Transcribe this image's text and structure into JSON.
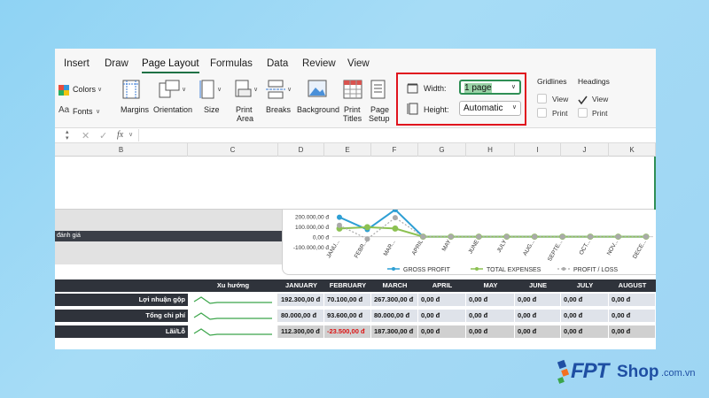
{
  "ribbon": {
    "tabs": [
      "Insert",
      "Draw",
      "Page Layout",
      "Formulas",
      "Data",
      "Review",
      "View"
    ],
    "active_tab": "Page Layout",
    "themes": {
      "colors": "Colors",
      "fonts": "Fonts"
    },
    "buttons": {
      "margins": "Margins",
      "orientation": "Orientation",
      "size": "Size",
      "print_area_1": "Print",
      "print_area_2": "Area",
      "breaks": "Breaks",
      "background": "Background",
      "print_titles_1": "Print",
      "print_titles_2": "Titles",
      "page_setup_1": "Page",
      "page_setup_2": "Setup"
    },
    "scale": {
      "width_label": "Width:",
      "width_value": "1 page",
      "height_label": "Height:",
      "height_value": "Automatic"
    },
    "gridlines": {
      "title": "Gridlines",
      "view": "View",
      "print": "Print",
      "view_checked": false,
      "print_checked": false
    },
    "headings": {
      "title": "Headings",
      "view": "View",
      "print": "Print",
      "view_checked": true,
      "print_checked": false
    }
  },
  "formula_bar": {
    "fx": "fx",
    "value": ""
  },
  "columns": [
    "B",
    "C",
    "D",
    "E",
    "F",
    "G",
    "H",
    "I",
    "J",
    "K"
  ],
  "sheet": {
    "danh_gia": "đánh giá"
  },
  "chart_data": {
    "type": "line",
    "categories": [
      "JANU...",
      "FEBR...",
      "MAR...",
      "APRIL",
      "MAY",
      "JUNE",
      "JULY",
      "AUG...",
      "SEPTE...",
      "OCT...",
      "NOV...",
      "DECE..."
    ],
    "y_ticks": [
      "200.000,00 đ",
      "100.000,00 đ",
      "0,00 đ",
      "-100.000,00 đ"
    ],
    "ylim": [
      -100000,
      250000
    ],
    "series": [
      {
        "name": "GROSS PROFIT",
        "color": "#2e9fd4",
        "values": [
          192300,
          70100,
          267300,
          0,
          0,
          0,
          0,
          0,
          0,
          0,
          0,
          0
        ]
      },
      {
        "name": "TOTAL EXPENSES",
        "color": "#8cc152",
        "values": [
          80000,
          93600,
          80000,
          0,
          0,
          0,
          0,
          0,
          0,
          0,
          0,
          0
        ]
      },
      {
        "name": "PROFIT / LOSS",
        "color": "#aaaaaa",
        "values": [
          112300,
          -23500,
          187300,
          0,
          0,
          0,
          0,
          0,
          0,
          0,
          0,
          0
        ]
      }
    ]
  },
  "table": {
    "trend_header": "Xu hướng",
    "months": [
      "JANUARY",
      "FEBRUARY",
      "MARCH",
      "APRIL",
      "MAY",
      "JUNE",
      "JULY",
      "AUGUST"
    ],
    "rows": [
      {
        "label": "Lợi nhuận gộp",
        "values": [
          "192.300,00 đ",
          "70.100,00 đ",
          "267.300,00 đ",
          "0,00 đ",
          "0,00 đ",
          "0,00 đ",
          "0,00 đ",
          "0,00 đ"
        ]
      },
      {
        "label": "Tổng chi phí",
        "values": [
          "80.000,00 đ",
          "93.600,00 đ",
          "80.000,00 đ",
          "0,00 đ",
          "0,00 đ",
          "0,00 đ",
          "0,00 đ",
          "0,00 đ"
        ]
      },
      {
        "label": "Lãi/Lỗ",
        "values": [
          "112.300,00 đ",
          "-23.500,00 đ",
          "187.300,00 đ",
          "0,00 đ",
          "0,00 đ",
          "0,00 đ",
          "0,00 đ",
          "0,00 đ"
        ]
      }
    ]
  },
  "logo": {
    "brand": "FPT",
    "shop": "Shop",
    "domain": ".com.vn"
  }
}
